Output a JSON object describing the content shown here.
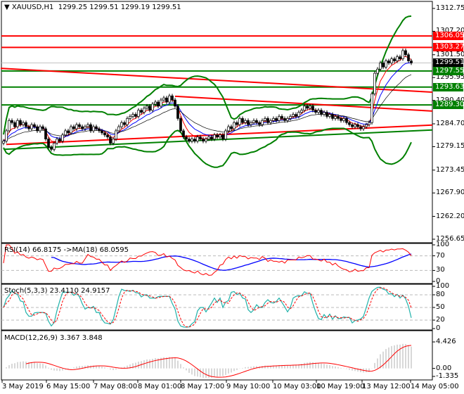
{
  "header": {
    "symbol": "XAUUSD,H1",
    "ohlc": "1299.25 1299.51 1299.19 1299.51"
  },
  "price_axis": {
    "ticks": [
      "1312.75",
      "1307.20",
      "1301.50",
      "1295.95",
      "1290.40",
      "1284.70",
      "1279.15",
      "1273.45",
      "1267.90",
      "1262.20",
      "1256.65"
    ],
    "range": [
      1256.65,
      1312.75
    ]
  },
  "levels": [
    {
      "label": "1306.05",
      "value": 1306.05,
      "color": "#ff0000"
    },
    {
      "label": "1303.27",
      "value": 1303.27,
      "color": "#ff0000"
    },
    {
      "label": "1299.51",
      "value": 1299.51,
      "color": "#000000",
      "line": "#c0c0c0"
    },
    {
      "label": "1297.55",
      "value": 1297.55,
      "color": "#008000"
    },
    {
      "label": "1293.63",
      "value": 1293.63,
      "color": "#008000"
    },
    {
      "label": "1289.30",
      "value": 1289.3,
      "color": "#008000"
    }
  ],
  "trendlines": [
    {
      "color": "#ff0000",
      "from": [
        -1,
        1298.2
      ],
      "to": [
        152.5,
        1292.4
      ]
    },
    {
      "color": "#ff0000",
      "from": [
        61,
        1291.4
      ],
      "to": [
        152.5,
        1287.8
      ]
    },
    {
      "color": "#ff0000",
      "from": [
        1,
        1279.7
      ],
      "to": [
        152.5,
        1284.4
      ]
    },
    {
      "color": "#008000",
      "from": [
        0,
        1278.5
      ],
      "to": [
        152.5,
        1283.2
      ]
    }
  ],
  "rsi": {
    "label": "RSI(14) 66.8175  ->MA(18) 68.0595",
    "axis": [
      "100",
      "70",
      "30",
      "0"
    ]
  },
  "stoch": {
    "label": "Stoch(5,3,3) 23.4110 24.9157",
    "axis": [
      "100",
      "80",
      "50",
      "20",
      "0"
    ]
  },
  "macd": {
    "label": "MACD(12,26,9) 3.367 3.848",
    "axis": [
      "4.426",
      "0.00",
      "-1.335"
    ],
    "range": [
      -1.335,
      4.426
    ]
  },
  "time_axis": [
    "3 May 2019",
    "6 May 15:00",
    "7 May 08:00",
    "8 May 01:00",
    "8 May 17:00",
    "9 May 10:00",
    "10 May 03:00",
    "10 May 19:00",
    "13 May 12:00",
    "14 May 05:00"
  ],
  "chart_data": {
    "type": "candlestick",
    "title": "XAUUSD,H1",
    "ylim": [
      1256.65,
      1312.75
    ],
    "closes": [
      1280.5,
      1283,
      1285.5,
      1285,
      1284,
      1285.5,
      1284.5,
      1285,
      1284,
      1283.5,
      1284.5,
      1284,
      1283,
      1284,
      1283.5,
      1281,
      1279,
      1278.5,
      1280,
      1281,
      1280.5,
      1282,
      1283,
      1282.5,
      1284,
      1283.5,
      1284.5,
      1284,
      1283.5,
      1284,
      1284.5,
      1283,
      1284,
      1283.5,
      1283,
      1282.5,
      1282,
      1281.5,
      1280,
      1281,
      1283,
      1284,
      1285,
      1284.5,
      1286,
      1286.5,
      1287,
      1286.5,
      1288,
      1287.5,
      1288.5,
      1289,
      1288,
      1289.5,
      1290,
      1289,
      1290.5,
      1291,
      1290,
      1291.5,
      1290.5,
      1289,
      1286,
      1283,
      1281.5,
      1281,
      1280.5,
      1281,
      1280.5,
      1281.5,
      1281,
      1280.5,
      1281,
      1281.5,
      1281,
      1282,
      1281.5,
      1282,
      1281,
      1283,
      1284,
      1283.5,
      1285,
      1284.5,
      1286,
      1285,
      1285.5,
      1284.5,
      1285,
      1285.5,
      1285,
      1284.5,
      1285.5,
      1286,
      1285,
      1285.5,
      1286,
      1285.5,
      1286.5,
      1286,
      1285.5,
      1286,
      1286.5,
      1287,
      1286.5,
      1287.5,
      1288,
      1289,
      1288.5,
      1289,
      1288,
      1287.5,
      1288,
      1287,
      1287.5,
      1286.5,
      1287,
      1286,
      1286.5,
      1286,
      1285.5,
      1286,
      1285,
      1284.5,
      1284,
      1284.5,
      1284,
      1283.5,
      1284,
      1284.5,
      1285,
      1292,
      1297,
      1298,
      1299.5,
      1298.5,
      1300,
      1299.5,
      1300.5,
      1300,
      1301,
      1300.5,
      1302.5,
      1301.5,
      1300,
      1299.5
    ]
  }
}
